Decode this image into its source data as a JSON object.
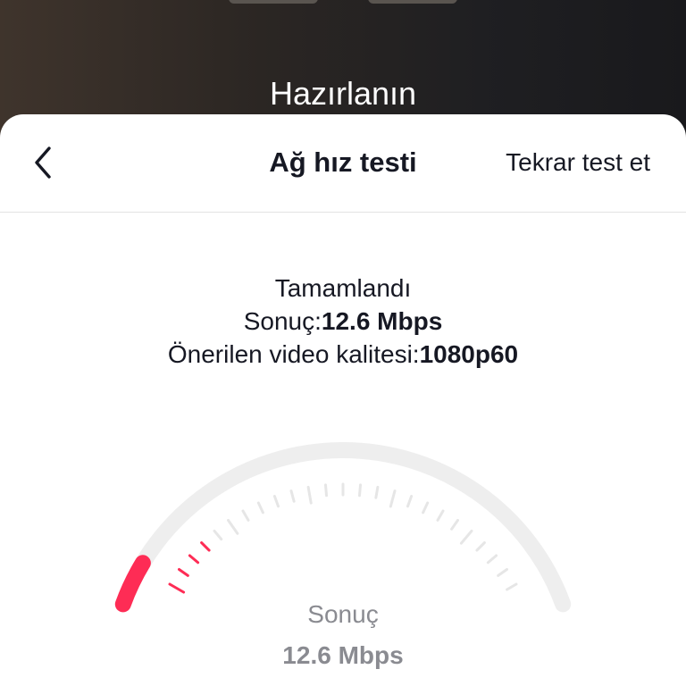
{
  "background": {
    "title": "Hazırlanın"
  },
  "header": {
    "title": "Ağ hız testi",
    "retest_label": "Tekrar test et"
  },
  "results": {
    "status": "Tamamlandı",
    "result_label": "Sonuç:",
    "result_value": "12.6 Mbps",
    "quality_label": "Önerilen video kalitesi:",
    "quality_value": "1080p60"
  },
  "gauge": {
    "label": "Sonuç",
    "value_text": "12.6 Mbps",
    "level_fraction": 0.08,
    "colors": {
      "track": "#eeeeee",
      "active": "#fe2c55",
      "tick": "#e6e6e6"
    }
  },
  "colors": {
    "accent": "#fe2c55",
    "text_primary": "#161823",
    "text_secondary": "#8a8b91"
  },
  "icons": {
    "back": "chevron-left-icon"
  }
}
